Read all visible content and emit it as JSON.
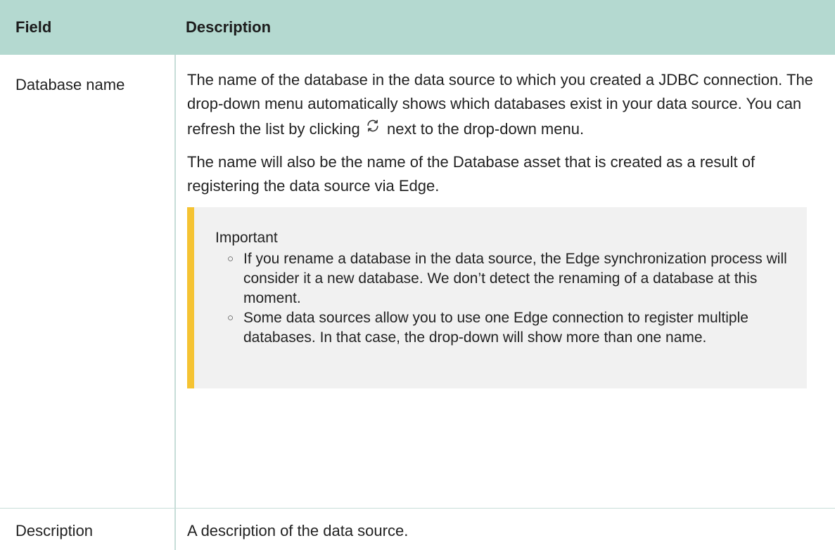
{
  "table": {
    "headers": {
      "field": "Field",
      "description": "Description"
    },
    "rows": [
      {
        "field": "Database name",
        "description": {
          "para1_before_icon": "The name of the database in the data source to which you created a JDBC connection. The drop-down menu automatically shows which databases exist in your data source. You can refresh the list by clicking",
          "para1_icon": "refresh-icon",
          "para1_after_icon": "next to the drop-down menu.",
          "para2": "The name will also be the name of the Database asset that is created as a result of registering the data source via Edge.",
          "callout": {
            "title": "Important",
            "items": [
              "If you rename a database in the data source, the Edge synchronization process will consider it a new database. We don’t detect the renaming of a database at this moment.",
              "Some data sources allow you to use one Edge connection to register multiple databases. In that case, the drop-down will show more than one name."
            ],
            "accent_color": "#f5c332"
          }
        }
      },
      {
        "field": "Description",
        "description": {
          "text": "A description of the data source."
        }
      }
    ],
    "header_color": "#b4d9d0"
  }
}
